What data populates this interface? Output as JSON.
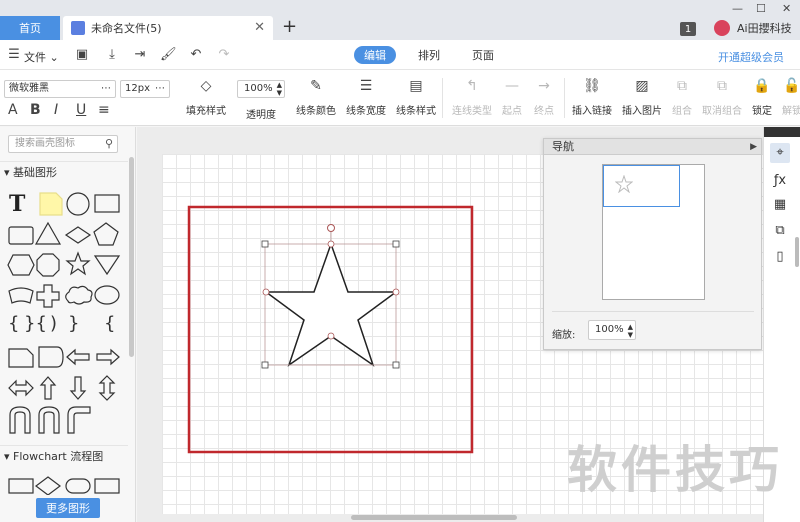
{
  "titlebar": {
    "home_tab": "首页",
    "doc_tab": "未命名文件(5)",
    "new_tab": "+",
    "close": "✕",
    "badge": "1",
    "user_name": "Ai田攖科技",
    "win_controls": [
      "—",
      "☐",
      "✕"
    ]
  },
  "menubar": {
    "file_menu": "文件",
    "modes": [
      "编辑",
      "排列",
      "页面"
    ],
    "active_mode": "编辑",
    "vip_link": "开通超级会员"
  },
  "toolbar": {
    "font_family": "微软雅黑",
    "font_size": "12px",
    "format_buttons": [
      "A",
      "B",
      "I",
      "U",
      "≡"
    ],
    "opacity": "100%",
    "tools": [
      {
        "label": "填充样式",
        "icon": "fill-icon",
        "disabled": false
      },
      {
        "label": "透明度",
        "icon": "opacity-icon",
        "disabled": false
      },
      {
        "label": "线条颜色",
        "icon": "pen-icon",
        "disabled": false
      },
      {
        "label": "线条宽度",
        "icon": "line-width-icon",
        "disabled": false
      },
      {
        "label": "线条样式",
        "icon": "line-style-icon",
        "disabled": false
      },
      {
        "label": "连线类型",
        "icon": "connector-icon",
        "disabled": true
      },
      {
        "label": "起点",
        "icon": "start-point-icon",
        "disabled": true
      },
      {
        "label": "终点",
        "icon": "end-point-icon",
        "disabled": true
      },
      {
        "label": "插入链接",
        "icon": "link-icon",
        "disabled": false
      },
      {
        "label": "插入图片",
        "icon": "image-icon",
        "disabled": false
      },
      {
        "label": "组合",
        "icon": "group-icon",
        "disabled": true
      },
      {
        "label": "取消组合",
        "icon": "ungroup-icon",
        "disabled": true
      },
      {
        "label": "锁定",
        "icon": "lock-icon",
        "disabled": false
      },
      {
        "label": "解锁",
        "icon": "unlock-icon",
        "disabled": true
      }
    ]
  },
  "leftpanel": {
    "search_placeholder": "搜索画壳图标",
    "section_basic": "基础图形",
    "section_flowchart": "Flowchart 流程图",
    "more_button": "更多图形"
  },
  "navigator": {
    "title": "导航",
    "zoom_label": "缩放:",
    "zoom_value": "100%"
  },
  "watermark": "软件技巧",
  "colors": {
    "accent": "#4a90e2",
    "frame_red": "#c0282d",
    "star_stroke": "#222222"
  }
}
